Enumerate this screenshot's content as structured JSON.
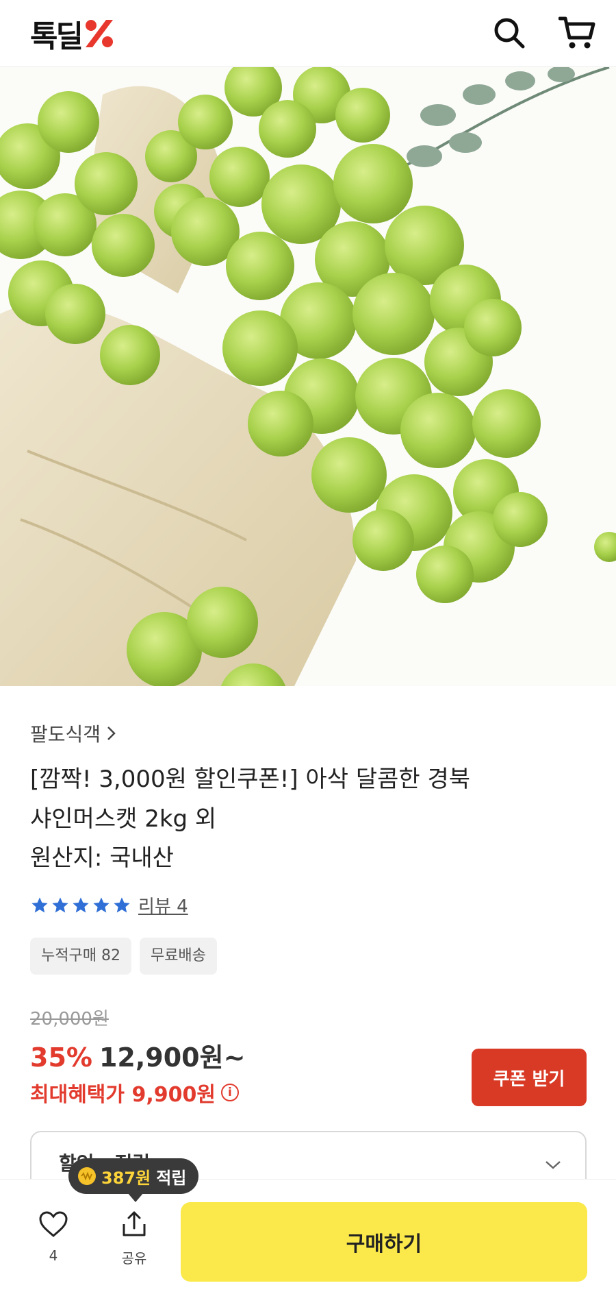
{
  "header": {
    "logo_text": "톡딜",
    "brand_color": "#e8372c"
  },
  "hero": {
    "image_alt": "shine muscat grapes on linen cloth",
    "slide_count": 6,
    "active_slide": 1
  },
  "product": {
    "seller": "팔도식객",
    "title_line1": "[깜짝! 3,000원 할인쿠폰!] 아삭 달콤한 경북",
    "title_line2": "샤인머스캣 2kg 외",
    "origin": "원산지: 국내산",
    "rating_stars": 5,
    "review_label": "리뷰 4",
    "badges": [
      "누적구매 82",
      "무료배송"
    ],
    "original_price": "20,000원",
    "discount": "35%",
    "price": "12,900원~",
    "max_benefit": "최대혜택가 9,900원",
    "info_icon": "i",
    "coupon_button": "쿠폰 받기",
    "dropdown_label": "할인 · 적립"
  },
  "bottom_bar": {
    "like_count": "4",
    "share_label": "공유",
    "buy_button": "구매하기",
    "points_value": "387원",
    "points_suffix": "적립"
  },
  "colors": {
    "accent_red": "#e23b2e",
    "coupon_red": "#d93a26",
    "buy_yellow": "#fbe94b",
    "star_blue": "#2f6fd6"
  }
}
